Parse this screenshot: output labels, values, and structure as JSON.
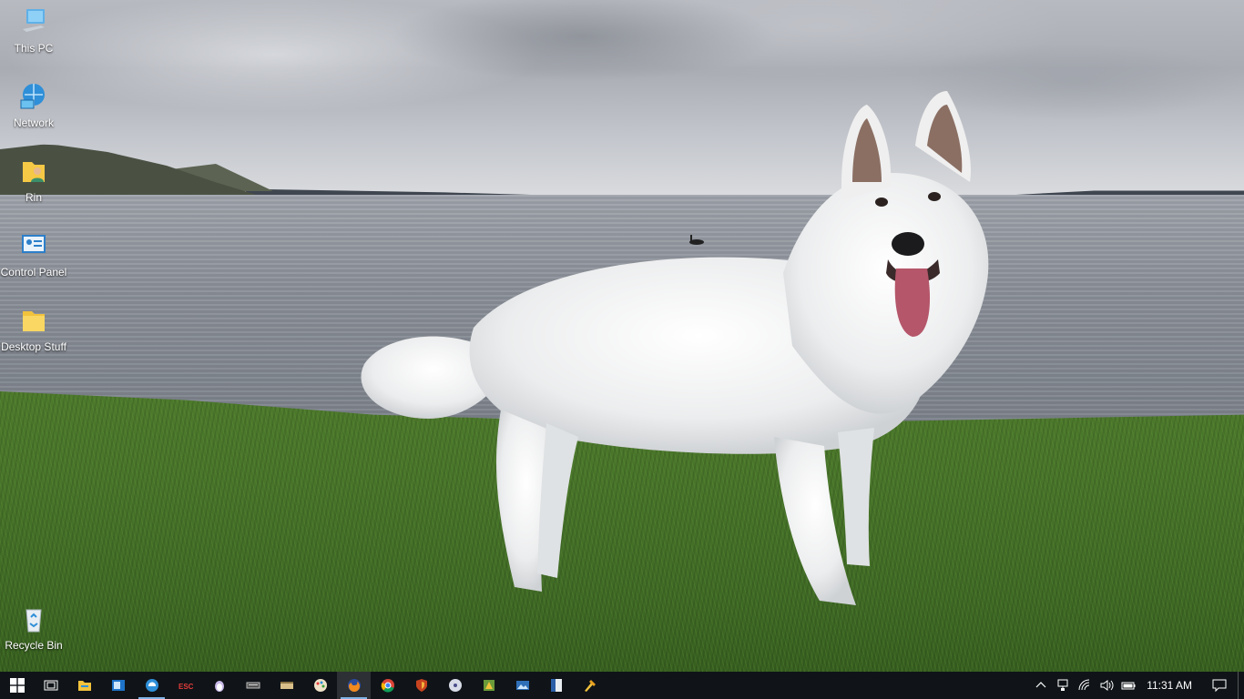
{
  "desktop": {
    "wallpaper": "white dog on grass by a lake",
    "icons": [
      {
        "label": "This PC",
        "icon": "computer-icon"
      },
      {
        "label": "Network",
        "icon": "network-icon"
      },
      {
        "label": "Rin",
        "icon": "user-folder-icon"
      },
      {
        "label": "Control Panel",
        "icon": "control-panel-icon"
      },
      {
        "label": "Desktop Stuff",
        "icon": "folder-icon"
      },
      {
        "label": "Recycle Bin",
        "icon": "recycle-bin-icon"
      }
    ]
  },
  "taskbar": {
    "start": {
      "icon": "windows-logo-icon"
    },
    "apps": [
      {
        "icon": "task-view-icon",
        "running": false
      },
      {
        "icon": "file-explorer-icon",
        "running": false
      },
      {
        "icon": "outlook-icon",
        "running": false
      },
      {
        "icon": "edge-browser-icon",
        "running": true
      },
      {
        "icon": "esc-app-icon",
        "running": false
      },
      {
        "icon": "penguin-app-icon",
        "running": false
      },
      {
        "icon": "keyboard-app-icon",
        "running": false
      },
      {
        "icon": "scanner-app-icon",
        "running": false
      },
      {
        "icon": "paint-app-icon",
        "running": false
      },
      {
        "icon": "firefox-icon",
        "running": true,
        "active": true
      },
      {
        "icon": "chrome-icon",
        "running": false
      },
      {
        "icon": "shield-app-icon",
        "running": false
      },
      {
        "icon": "media-disc-icon",
        "running": false
      },
      {
        "icon": "game-app-icon",
        "running": false
      },
      {
        "icon": "photo-viewer-icon",
        "running": false
      },
      {
        "icon": "document-app-icon",
        "running": false
      },
      {
        "icon": "tools-app-icon",
        "running": false
      }
    ],
    "tray": {
      "icons": [
        "chevron-up-icon",
        "network-wired-icon",
        "wifi-icon",
        "volume-icon",
        "battery-icon"
      ],
      "time": "11:31 AM",
      "notification_icon": "action-center-icon"
    }
  },
  "colors": {
    "taskbar_bg": "#101418",
    "running_indicator": "#7fb2e5"
  }
}
